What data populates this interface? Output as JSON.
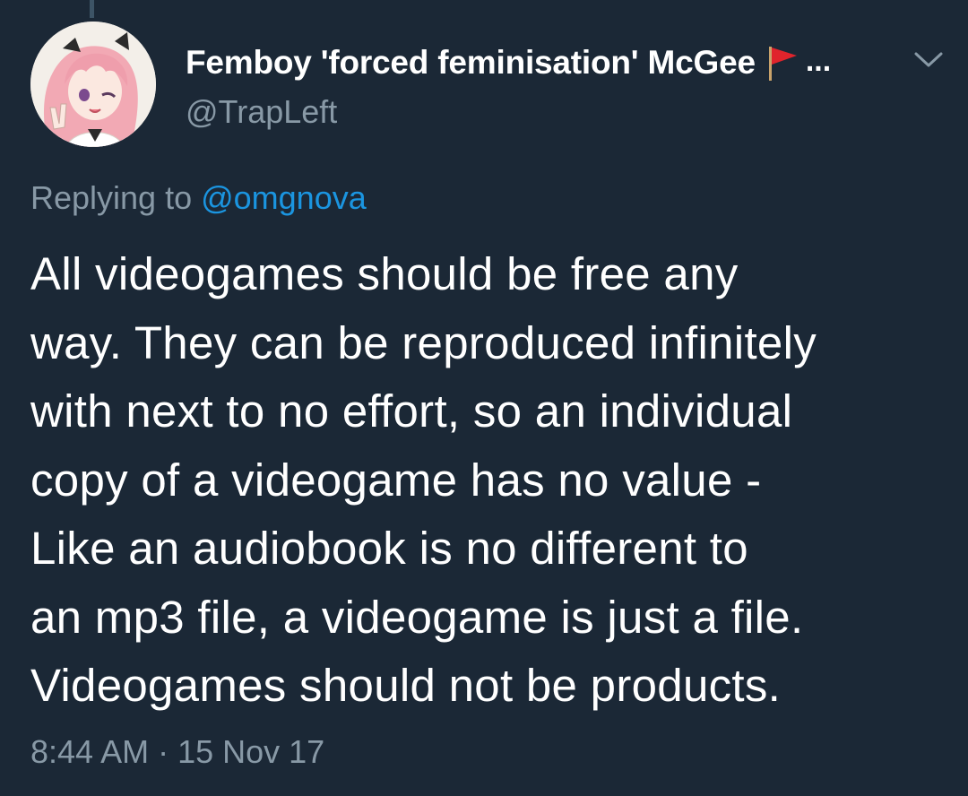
{
  "author": {
    "display_name": "Femboy 'forced feminisation' McGee",
    "flag_icon": "red-flag-icon",
    "overflow_text": "...",
    "handle": "@TrapLeft"
  },
  "reply": {
    "prefix": "Replying to ",
    "target": "@omgnova"
  },
  "tweet": {
    "lines": [
      "All videogames should be free any",
      "way. They can be reproduced infinitely",
      "with next to no effort, so an individual",
      "copy of a videogame has no value -",
      "Like an audiobook is no different to",
      "an mp3 file, a videogame is just a file.",
      "Videogames should not be products."
    ],
    "timestamp": "8:44 AM · 15 Nov 17"
  },
  "icons": {
    "menu": "chevron-down-icon",
    "avatar": "avatar"
  },
  "colors": {
    "background": "#1b2836",
    "primary_text": "#ffffff",
    "secondary_text": "#8899a6",
    "link": "#1b95e0",
    "flag_red": "#e0242c"
  }
}
